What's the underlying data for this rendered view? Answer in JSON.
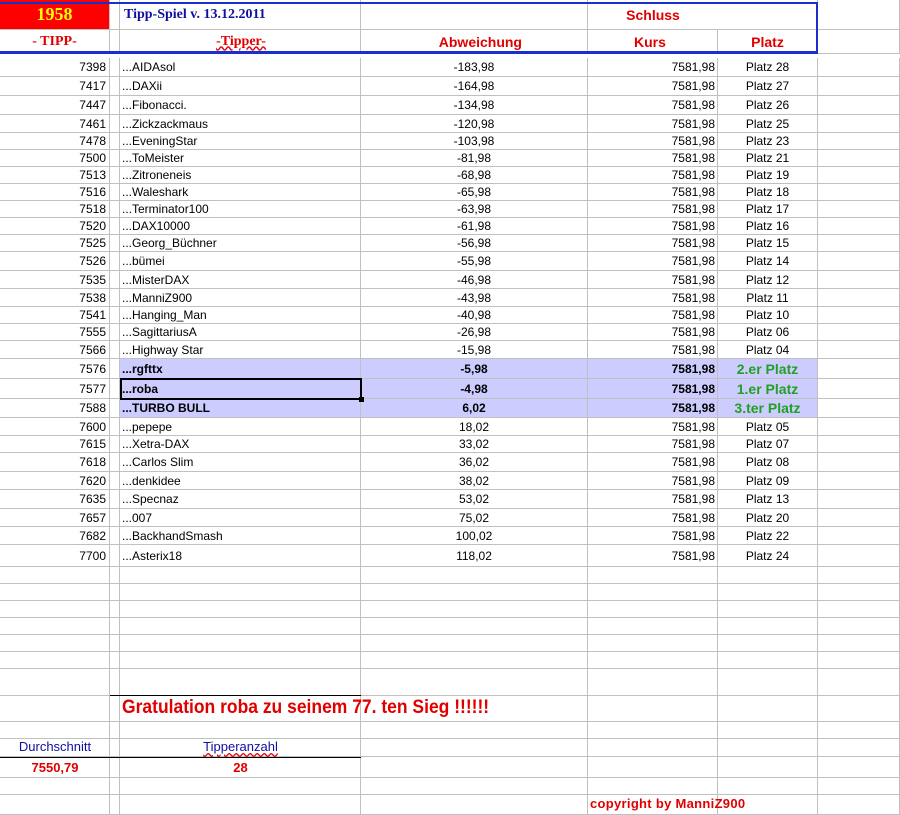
{
  "header": {
    "year": "1958",
    "title": "Tipp-Spiel v. 13.12.2011",
    "schluss": "Schluss",
    "col_tipp": "- TIPP-",
    "col_tipper": "-Tipper-",
    "col_abweichung": "Abweichung",
    "col_kurs": "Kurs",
    "col_platz": "Platz"
  },
  "rows": [
    [
      "7398",
      "...AIDAsol",
      "-183,98",
      "7581,98",
      "Platz 28"
    ],
    [
      "7417",
      "...DAXii",
      "-164,98",
      "7581,98",
      "Platz 27"
    ],
    [
      "7447",
      "...Fibonacci.",
      "-134,98",
      "7581,98",
      "Platz 26"
    ],
    [
      "7461",
      "...Zickzackmaus",
      "-120,98",
      "7581,98",
      "Platz 25"
    ],
    [
      "7478",
      "...EveningStar",
      "-103,98",
      "7581,98",
      "Platz 23"
    ],
    [
      "7500",
      "...ToMeister",
      "-81,98",
      "7581,98",
      "Platz 21"
    ],
    [
      "7513",
      "...Zitroneneis",
      "-68,98",
      "7581,98",
      "Platz 19"
    ],
    [
      "7516",
      "...Waleshark",
      "-65,98",
      "7581,98",
      "Platz 18"
    ],
    [
      "7518",
      "...Terminator100",
      "-63,98",
      "7581,98",
      "Platz 17"
    ],
    [
      "7520",
      "...DAX10000",
      "-61,98",
      "7581,98",
      "Platz 16"
    ],
    [
      "7525",
      "...Georg_Büchner",
      "-56,98",
      "7581,98",
      "Platz 15"
    ],
    [
      "7526",
      "...bümei",
      "-55,98",
      "7581,98",
      "Platz 14"
    ],
    [
      "7535",
      "...MisterDAX",
      "-46,98",
      "7581,98",
      "Platz 12"
    ],
    [
      "7538",
      "...ManniZ900",
      "-43,98",
      "7581,98",
      "Platz 11"
    ],
    [
      "7541",
      "...Hanging_Man",
      "-40,98",
      "7581,98",
      "Platz 10"
    ],
    [
      "7555",
      "...SagittariusA",
      "-26,98",
      "7581,98",
      "Platz 06"
    ],
    [
      "7566",
      "...Highway Star",
      "-15,98",
      "7581,98",
      "Platz 04"
    ],
    [
      "7576",
      "...rgfttx",
      "-5,98",
      "7581,98",
      "2.er Platz"
    ],
    [
      "7577",
      "...roba",
      "-4,98",
      "7581,98",
      "1.er Platz"
    ],
    [
      "7588",
      "...TURBO BULL",
      "6,02",
      "7581,98",
      "3.ter Platz"
    ],
    [
      "7600",
      "...pepepe",
      "18,02",
      "7581,98",
      "Platz 05"
    ],
    [
      "7615",
      "...Xetra-DAX",
      "33,02",
      "7581,98",
      "Platz 07"
    ],
    [
      "7618",
      "...Carlos Slim",
      "36,02",
      "7581,98",
      "Platz 08"
    ],
    [
      "7620",
      "...denkidee",
      "38,02",
      "7581,98",
      "Platz 09"
    ],
    [
      "7635",
      "...Specnaz",
      "53,02",
      "7581,98",
      "Platz 13"
    ],
    [
      "7657",
      "...007",
      "75,02",
      "7581,98",
      "Platz 20"
    ],
    [
      "7682",
      "...BackhandSmash",
      "100,02",
      "7581,98",
      "Platz 22"
    ],
    [
      "7700",
      "...Asterix18",
      "118,02",
      "7581,98",
      "Platz 24"
    ]
  ],
  "footer": {
    "gratulation": "Gratulation  roba  zu seinem  77. ten Sieg !!!!!!",
    "durchschnitt_label": "Durchschnitt",
    "durchschnitt_value": "7550,79",
    "tipperanzahl_label": "Tipperanzahl",
    "tipperanzahl_value": "28",
    "copyright": "copyright by ManniZ900"
  },
  "colors": {
    "highlight": "#ccccff",
    "header_red": "#ff0000",
    "title_blue": "#1010a0",
    "winner_green": "#22a022"
  }
}
